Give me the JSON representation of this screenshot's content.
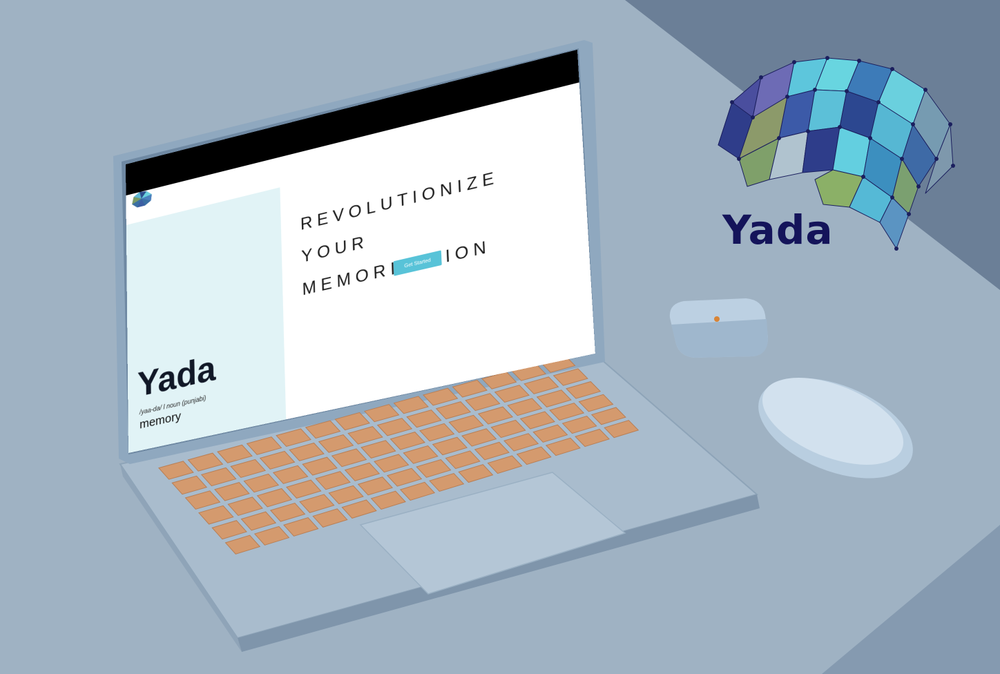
{
  "brand": {
    "name": "Yada",
    "color": "#14145a"
  },
  "laptop_screen": {
    "hero_title": "REVOLUTIONIZE YOUR MEMORIZATION",
    "cta_label": "Get Started",
    "cta_color": "#58c3d8",
    "side_panel_color": "#e1f3f6",
    "definition": {
      "word": "Yada",
      "phonetic": "/yaa-da/ l noun (punjabi)",
      "meaning": "memory"
    }
  },
  "icons": {
    "mini_logo": "brain-icon",
    "brand_logo": "brain-icon"
  }
}
